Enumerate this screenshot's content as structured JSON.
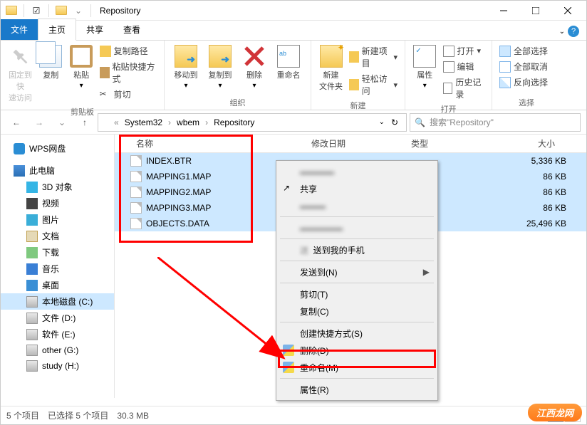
{
  "titlebar": {
    "title": "Repository"
  },
  "tabs": {
    "file": "文件",
    "home": "主页",
    "share": "共享",
    "view": "查看"
  },
  "ribbon": {
    "clipboard": {
      "pin": "固定到快\n速访问",
      "copy": "复制",
      "paste": "粘贴",
      "copypath": "复制路径",
      "pasteshortcut": "粘贴快捷方式",
      "cut": "剪切",
      "label": "剪贴板"
    },
    "organize": {
      "moveto": "移动到",
      "copyto": "复制到",
      "delete": "删除",
      "rename": "重命名",
      "label": "组织"
    },
    "new": {
      "newfolder": "新建\n文件夹",
      "newitem": "新建项目",
      "easyaccess": "轻松访问",
      "label": "新建"
    },
    "open": {
      "props": "属性",
      "open": "打开",
      "edit": "编辑",
      "history": "历史记录",
      "label": "打开"
    },
    "select": {
      "all": "全部选择",
      "none": "全部取消",
      "invert": "反向选择",
      "label": "选择"
    }
  },
  "breadcrumb": {
    "b1": "System32",
    "b2": "wbem",
    "b3": "Repository"
  },
  "search": {
    "placeholder": "搜索\"Repository\""
  },
  "tree": {
    "wps": "WPS网盘",
    "pc": "此电脑",
    "3d": "3D 对象",
    "video": "视频",
    "pic": "图片",
    "doc": "文档",
    "dl": "下载",
    "music": "音乐",
    "desktop": "桌面",
    "cdrive": "本地磁盘 (C:)",
    "ddrive": "文件 (D:)",
    "edrive": "软件 (E:)",
    "gdrive": "other (G:)",
    "hdrive": "study (H:)"
  },
  "columns": {
    "name": "名称",
    "date": "修改日期",
    "type": "类型",
    "size": "大小"
  },
  "files": [
    {
      "name": "INDEX.BTR",
      "size": "5,336 KB"
    },
    {
      "name": "MAPPING1.MAP",
      "size": "86 KB"
    },
    {
      "name": "MAPPING2.MAP",
      "size": "86 KB"
    },
    {
      "name": "MAPPING3.MAP",
      "size": "86 KB"
    },
    {
      "name": "OBJECTS.DATA",
      "size": "25,496 KB"
    }
  ],
  "ctx": {
    "share": "共享",
    "sendphone": "送到我的手机",
    "sendto": "发送到(N)",
    "cut": "剪切(T)",
    "copy": "复制(C)",
    "shortcut": "创建快捷方式(S)",
    "delete": "删除(D)",
    "rename": "重命名(M)",
    "props": "属性(R)"
  },
  "status": {
    "items": "5 个项目",
    "selected": "已选择 5 个项目",
    "size": "30.3 MB"
  },
  "watermark": "江西龙网"
}
